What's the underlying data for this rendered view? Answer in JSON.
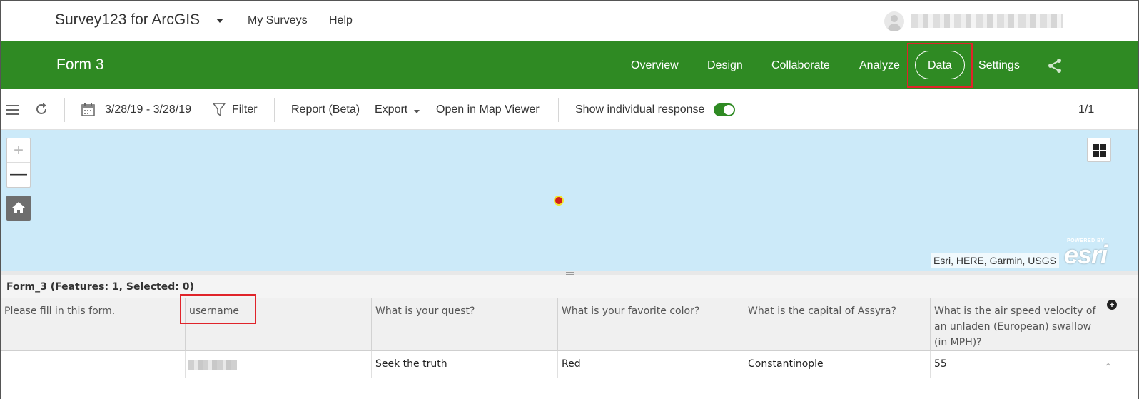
{
  "topbar": {
    "app_title": "Survey123 for ArcGIS",
    "links": [
      "My Surveys",
      "Help"
    ]
  },
  "header": {
    "form_title": "Form 3",
    "nav": [
      "Overview",
      "Design",
      "Collaborate",
      "Analyze",
      "Data",
      "Settings"
    ],
    "active_nav": "Data",
    "accent_color": "#2f8a23",
    "highlight_color": "#e0242a"
  },
  "toolbar": {
    "date_range": "3/28/19 - 3/28/19",
    "filter_label": "Filter",
    "report_label": "Report (Beta)",
    "export_label": "Export",
    "map_viewer_label": "Open in Map Viewer",
    "individual_response_label": "Show individual response",
    "individual_response_on": true,
    "pager": "1/1"
  },
  "map": {
    "attribution": "Esri, HERE, Garmin, USGS",
    "logo_powered": "POWERED BY",
    "logo_word": "esri"
  },
  "table": {
    "title": "Form_3 (Features: 1, Selected: 0)",
    "columns": [
      "Please fill in this form.",
      "username",
      "What is your quest?",
      "What is your favorite color?",
      "What is the capital of Assyra?",
      "What is the air speed velocity of an unladen (European) swallow (in MPH)?"
    ],
    "rows": [
      [
        "",
        "",
        "Seek the truth",
        "Red",
        "Constantinople",
        "55"
      ]
    ]
  }
}
